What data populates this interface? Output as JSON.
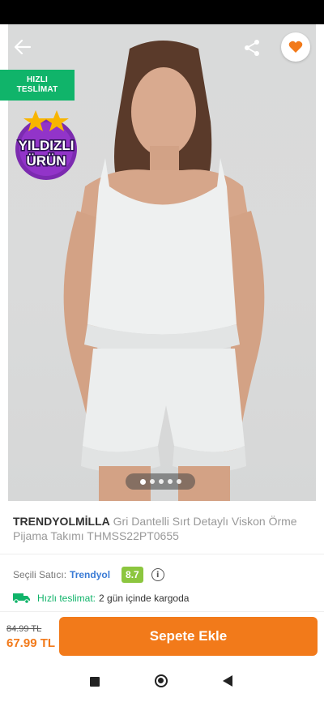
{
  "badges": {
    "fast_line1": "HIZLI",
    "fast_line2": "TESLİMAT",
    "star_line1": "YILDIZLI",
    "star_line2": "ÜRÜN"
  },
  "product": {
    "brand": "TRENDYOLMİLLA",
    "name": "Gri Dantelli Sırt Detaylı Viskon Örme Pijama Takımı THMSS22PT0655",
    "image_count": 5,
    "active_image": 1
  },
  "seller": {
    "label": "Seçili Satıcı:",
    "name": "Trendyol",
    "score": "8.7",
    "info_icon": "info-icon"
  },
  "delivery": {
    "icon": "truck-icon",
    "label": "Hızlı teslimat:",
    "value": "2 gün içinde kargoda"
  },
  "price": {
    "old": "84.99 TL",
    "new": "67.99 TL"
  },
  "cart": {
    "button_label": "Sepete Ekle"
  },
  "colors": {
    "accent": "#f27a1a",
    "fast_badge": "#10b46a",
    "score_badge": "#8cc63f",
    "seller_link": "#3a7bd5",
    "favorite_heart": "#f27a1a"
  },
  "icons": {
    "back": "arrow-left-icon",
    "share": "share-icon",
    "favorite": "heart-icon"
  }
}
